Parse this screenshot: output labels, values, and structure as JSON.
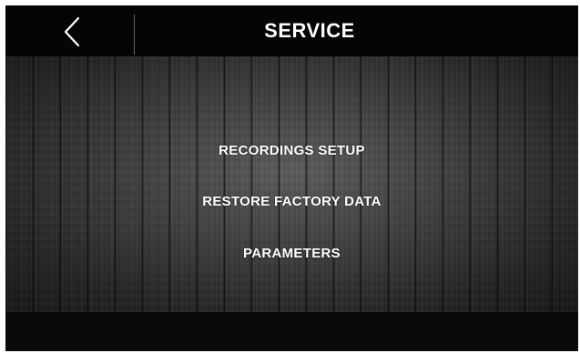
{
  "header": {
    "back_icon": "chevron-left-icon",
    "title": "SERVICE"
  },
  "menu": {
    "items": [
      {
        "label": "RECORDINGS SETUP"
      },
      {
        "label": "RESTORE FACTORY DATA"
      },
      {
        "label": "PARAMETERS"
      }
    ]
  },
  "colors": {
    "header_bg": "#050505",
    "text": "#ffffff",
    "panel": "#3e3e3e"
  }
}
